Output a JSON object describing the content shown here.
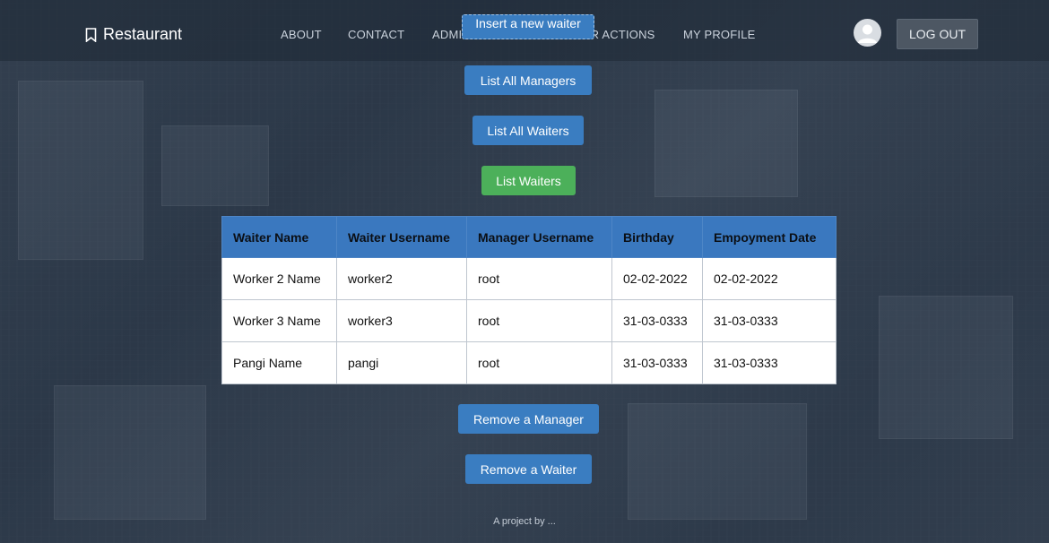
{
  "brand": {
    "name": "Restaurant",
    "icon": "bookmark-icon"
  },
  "nav": {
    "about": "ABOUT",
    "contact": "CONTACT",
    "admin_actions": "ADMIN ACTIONS",
    "waiter_actions": "WAITER ACTIONS",
    "my_profile": "MY PROFILE",
    "logout": "LOG OUT"
  },
  "actions": {
    "insert_waiter": "Insert a new waiter",
    "list_managers": "List All Managers",
    "list_all_waiters": "List All Waiters",
    "list_waiters": "List Waiters",
    "remove_manager": "Remove a Manager",
    "remove_waiter": "Remove a Waiter"
  },
  "table": {
    "headers": [
      "Waiter Name",
      "Waiter Username",
      "Manager Username",
      "Birthday",
      "Empoyment Date"
    ],
    "rows": [
      [
        "Worker 2 Name",
        "worker2",
        "root",
        "02-02-2022",
        "02-02-2022"
      ],
      [
        "Worker 3 Name",
        "worker3",
        "root",
        "31-03-0333",
        "31-03-0333"
      ],
      [
        "Pangi Name",
        "pangi",
        "root",
        "31-03-0333",
        "31-03-0333"
      ]
    ]
  },
  "footer": {
    "text": "A project by ..."
  },
  "colors": {
    "primary": "#3a7dc1",
    "success": "#4cb05a",
    "header_bg": "#3a78bf"
  }
}
